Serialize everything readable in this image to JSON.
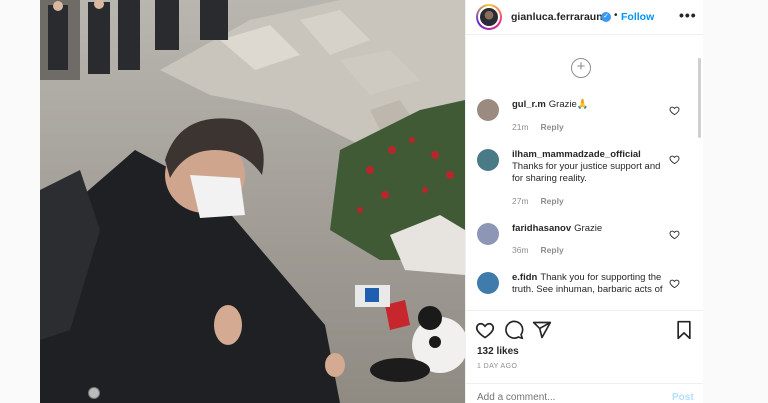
{
  "post": {
    "author": "gianluca.ferrarauno",
    "follow_label": "Follow",
    "follow_separator": "•",
    "more_label": "•••",
    "photo_next_label": "›"
  },
  "comments": {
    "load_more_symbol": "+",
    "items": [
      {
        "user": "gul_r.m",
        "text": "Grazie🙏",
        "time": "21m",
        "reply_label": "Reply",
        "avatar_color": "#9a8a80"
      },
      {
        "user": "ilham_mammadzade_official",
        "text": "Thanks for your justice support and for sharing reality.",
        "time": "27m",
        "reply_label": "Reply",
        "avatar_color": "#4a7a86"
      },
      {
        "user": "faridhasanov",
        "text": "Grazie",
        "time": "36m",
        "reply_label": "Reply",
        "avatar_color": "#8d96b5"
      },
      {
        "user": "e.fidn",
        "text": "Thank you for supporting the truth. See inhuman, barbaric acts of",
        "time": "",
        "reply_label": "",
        "avatar_color": "#3f7cac"
      }
    ]
  },
  "actions": {
    "likes": "132 likes",
    "date": "1 DAY AGO",
    "add_comment_placeholder": "Add a comment...",
    "post_label": "Post"
  },
  "colors": {
    "link_blue": "#0095f6",
    "verified_blue": "#3897f0",
    "muted_text": "#8e8e8e",
    "post_disabled": "#b2dffc"
  }
}
